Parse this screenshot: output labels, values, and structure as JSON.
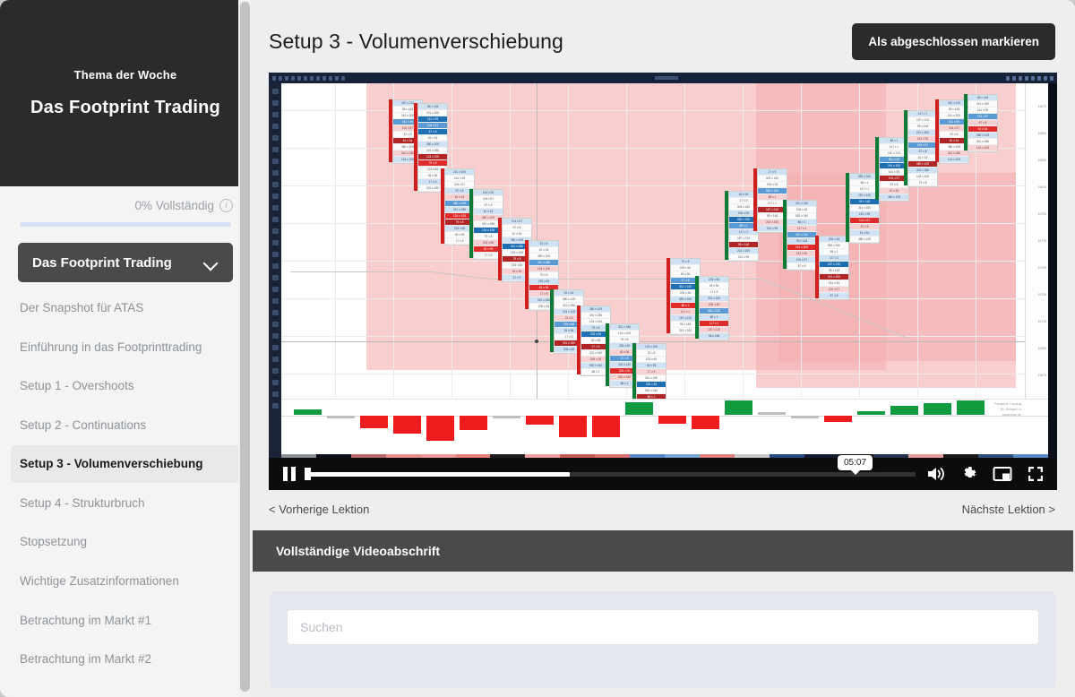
{
  "sidebar": {
    "hero": {
      "kicker": "Thema der Woche",
      "title": "Das Footprint Trading"
    },
    "progress": {
      "label": "0% Vollständig",
      "percent": 0,
      "info_icon": "info-icon"
    },
    "section": {
      "title": "Das Footprint Trading",
      "chevron_icon": "chevron-down-icon"
    },
    "lessons": [
      {
        "label": "Der Snapshot für ATAS",
        "active": false
      },
      {
        "label": "Einführung in das Footprinttrading",
        "active": false
      },
      {
        "label": "Setup 1 - Overshoots",
        "active": false
      },
      {
        "label": "Setup 2 - Continuations",
        "active": false
      },
      {
        "label": "Setup 3 - Volumenverschiebung",
        "active": true
      },
      {
        "label": "Setup 4 - Strukturbruch",
        "active": false
      },
      {
        "label": "Stopsetzung",
        "active": false
      },
      {
        "label": "Wichtige Zusatzinformationen",
        "active": false
      },
      {
        "label": "Betrachtung im Markt #1",
        "active": false
      },
      {
        "label": "Betrachtung im Markt #2",
        "active": false
      }
    ]
  },
  "main": {
    "lesson_title": "Setup 3 - Volumenverschiebung",
    "complete_button": "Als abgeschlossen markieren",
    "player": {
      "state_icon": "pause-icon",
      "current_time_tooltip": "05:07",
      "progress_percent": 43,
      "icons": [
        "volume-icon",
        "gear-icon",
        "miniplayer-icon",
        "fullscreen-icon"
      ]
    },
    "nav": {
      "prev": "< Vorherige Lektion",
      "next": "Nächste Lektion >"
    },
    "transcript": {
      "header": "Vollständige Videoabschrift",
      "search_placeholder": "Suchen",
      "search_value": ""
    }
  },
  "colors": {
    "hero_bg": "#2b2b2b",
    "section_bg": "#4a4a4a",
    "accent_blue": "#4a7fd4",
    "page_bg": "#eeeeee",
    "bullish": "#0f9b3e",
    "bearish": "#ee1c1c",
    "zone": "#f4b0b2"
  }
}
